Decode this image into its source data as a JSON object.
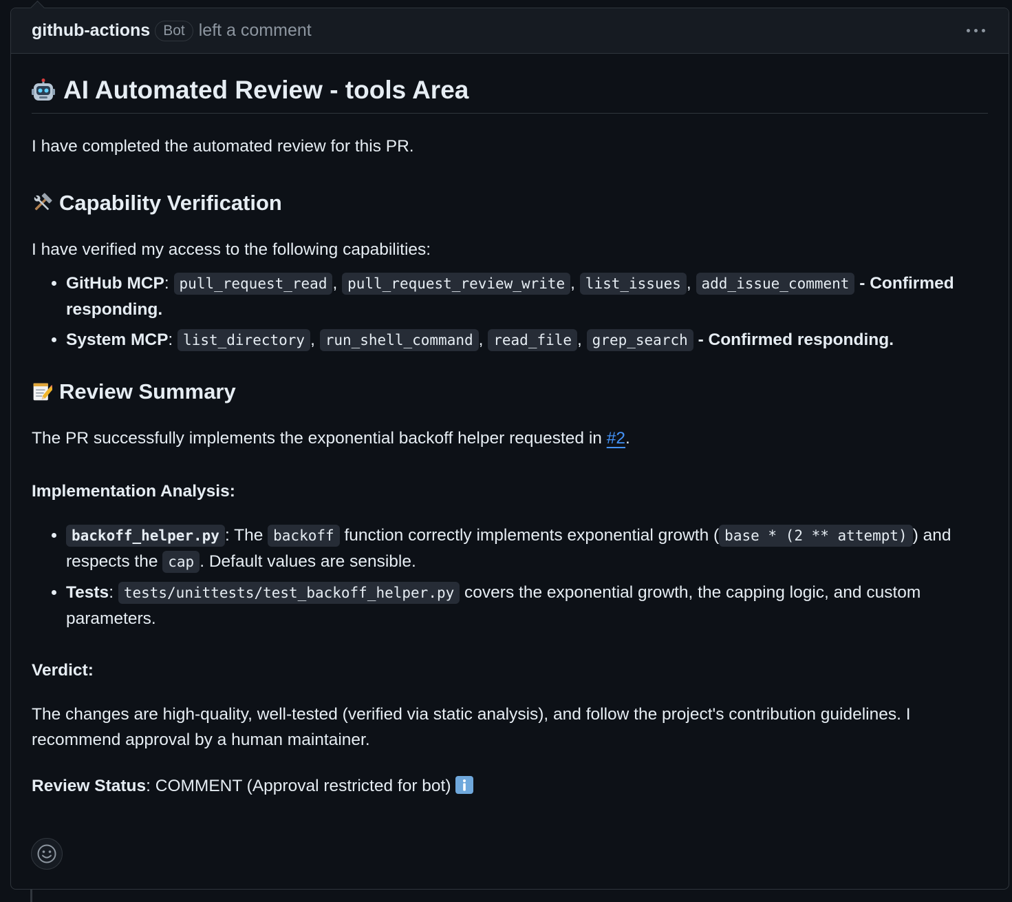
{
  "comment": {
    "author": "github-actions",
    "badge": "Bot",
    "action": "left a comment"
  },
  "title": {
    "icon": "robot-icon",
    "text": "AI Automated Review - tools Area"
  },
  "intro": "I have completed the automated review for this PR.",
  "capability": {
    "icon": "hammer-wrench-icon",
    "heading": "Capability Verification",
    "intro": "I have verified my access to the following capabilities:",
    "github_label": "GitHub MCP",
    "github_tools": [
      "pull_request_read",
      "pull_request_review_write",
      "list_issues",
      "add_issue_comment"
    ],
    "github_status": "- Confirmed responding.",
    "system_label": "System MCP",
    "system_tools": [
      "list_directory",
      "run_shell_command",
      "read_file",
      "grep_search"
    ],
    "system_status": "- Confirmed responding."
  },
  "summary": {
    "icon": "memo-icon",
    "heading": "Review Summary",
    "text_before": "The PR successfully implements the exponential backoff helper requested in ",
    "link": "#2",
    "text_after": "."
  },
  "analysis": {
    "heading": "Implementation Analysis:",
    "item1_file": "backoff_helper.py",
    "item1_a": ": The ",
    "item1_code1": "backoff",
    "item1_b": " function correctly implements exponential growth (",
    "item1_code2": "base * (2 ** attempt)",
    "item1_c": ") and respects the ",
    "item1_code3": "cap",
    "item1_d": ". Default values are sensible.",
    "item2_label": "Tests",
    "item2_sep": ": ",
    "item2_code": "tests/unittests/test_backoff_helper.py",
    "item2_text": " covers the exponential growth, the capping logic, and custom parameters."
  },
  "verdict": {
    "heading": "Verdict:",
    "text": "The changes are high-quality, well-tested (verified via static analysis), and follow the project's contribution guidelines. I recommend approval by a human maintainer."
  },
  "status": {
    "label": "Review Status",
    "sep": ": ",
    "value": "COMMENT (Approval restricted for bot) ",
    "icon": "info-icon"
  },
  "colors": {
    "background": "#0d1117",
    "link": "#4493f8",
    "border": "#30363d"
  }
}
